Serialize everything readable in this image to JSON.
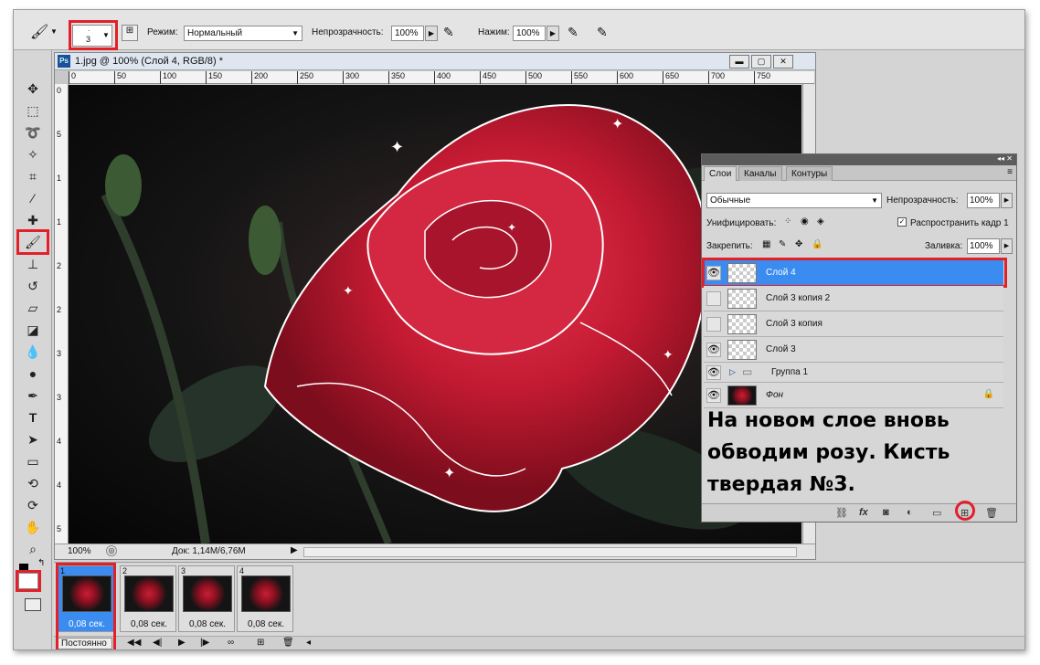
{
  "options_bar": {
    "brush_size": "3",
    "mode_label": "Режим:",
    "mode_value": "Нормальный",
    "opacity_label": "Непрозрачность:",
    "opacity_value": "100%",
    "flow_label": "Нажим:",
    "flow_value": "100%"
  },
  "document": {
    "title": "1.jpg @ 100% (Слой 4, RGB/8) *",
    "zoom": "100%",
    "doc_size": "Док: 1,14M/6,76M",
    "ruler_h": [
      "0",
      "50",
      "100",
      "150",
      "200",
      "250",
      "300",
      "350",
      "400",
      "450",
      "500",
      "550",
      "600",
      "650",
      "700",
      "750"
    ],
    "ruler_v": [
      "0",
      "5",
      "1",
      "1",
      "2",
      "2",
      "3",
      "3",
      "4",
      "4",
      "5"
    ]
  },
  "layers_panel": {
    "tabs": [
      "Слои",
      "Каналы",
      "Контуры"
    ],
    "blend_mode": "Обычные",
    "opacity_label": "Непрозрачность:",
    "opacity_value": "100%",
    "unify_label": "Унифицировать:",
    "propagate_label": "Распространить кадр 1",
    "lock_label": "Закрепить:",
    "fill_label": "Заливка:",
    "fill_value": "100%",
    "layers": [
      {
        "name": "Слой 4",
        "visible": true,
        "selected": true
      },
      {
        "name": "Слой 3 копия 2",
        "visible": false
      },
      {
        "name": "Слой 3 копия",
        "visible": false
      },
      {
        "name": "Слой 3",
        "visible": true
      },
      {
        "name": "Группа 1",
        "visible": true,
        "group": true
      },
      {
        "name": "Фон",
        "visible": true,
        "background": true
      }
    ],
    "note_text": "На новом слое вновь\nобводим розу.  Кисть\nтвердая №3."
  },
  "animation": {
    "frames": [
      {
        "num": "1",
        "delay": "0,08 сек."
      },
      {
        "num": "2",
        "delay": "0,08 сек."
      },
      {
        "num": "3",
        "delay": "0,08 сек."
      },
      {
        "num": "4",
        "delay": "0,08 сек."
      }
    ],
    "loop": "Постоянно"
  },
  "colors": {
    "selection_blue": "#3a8cf0",
    "annotation_red": "#e2202a"
  }
}
